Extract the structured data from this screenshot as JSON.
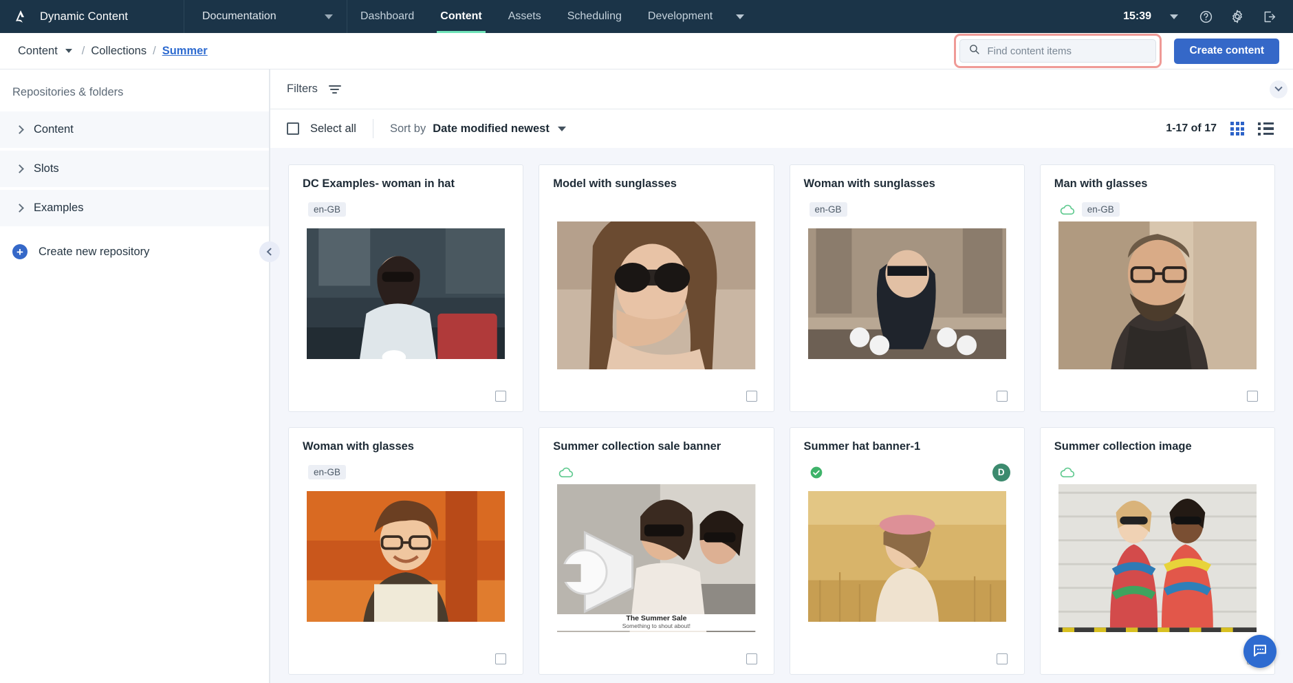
{
  "topnav": {
    "brand": "Dynamic Content",
    "section": {
      "label": "Documentation",
      "icon": "chevron-down-icon"
    },
    "items": [
      {
        "label": "Dashboard",
        "active": false,
        "caret": false
      },
      {
        "label": "Content",
        "active": true,
        "caret": false
      },
      {
        "label": "Assets",
        "active": false,
        "caret": false
      },
      {
        "label": "Scheduling",
        "active": false,
        "caret": false
      },
      {
        "label": "Development",
        "active": false,
        "caret": true
      }
    ],
    "clock": "15:39",
    "icons": [
      "chevron-down-icon",
      "help-icon",
      "gear-icon",
      "logout-icon"
    ]
  },
  "breadcrumb": {
    "items": [
      {
        "label": "Content",
        "caret": true,
        "active": false
      },
      {
        "label": "/",
        "sep": true
      },
      {
        "label": "Collections",
        "active": false
      },
      {
        "label": "/",
        "sep": true
      },
      {
        "label": "Summer",
        "active": true
      }
    ]
  },
  "search": {
    "placeholder": "Find content items",
    "value": "",
    "icon": "search-icon",
    "highlight_color": "#ef9a96"
  },
  "actions": {
    "create_content": "Create content",
    "accent": "#3568c8"
  },
  "sidebar": {
    "title": "Repositories & folders",
    "items": [
      {
        "label": "Content",
        "icon": "chevron-right-icon"
      },
      {
        "label": "Slots",
        "icon": "chevron-right-icon"
      },
      {
        "label": "Examples",
        "icon": "chevron-right-icon"
      }
    ],
    "create_repository": "Create new repository",
    "create_repository_icon": "plus-circle-icon"
  },
  "filterbar": {
    "label": "Filters",
    "icon": "filter-icon",
    "collapse_icon": "chevron-down-icon"
  },
  "toolbar": {
    "select_all": "Select all",
    "sort_by_label": "Sort by",
    "sort_by_value": "Date modified newest",
    "sort_caret": "chevron-down-icon",
    "count": "1-17 of 17",
    "grid_view_icon": "grid-view-icon",
    "list_view_icon": "list-view-icon",
    "collapse_panel_icon": "chevron-left-icon"
  },
  "cards": [
    {
      "title": "DC Examples- woman in hat",
      "locale": "en-GB",
      "status_icon": null,
      "avatar": null,
      "thumb": "woman-in-hat",
      "checkbox": false
    },
    {
      "title": "Model with sunglasses",
      "locale": null,
      "status_icon": null,
      "avatar": null,
      "thumb": "model-sunglasses",
      "checkbox": false
    },
    {
      "title": "Woman with sunglasses",
      "locale": "en-GB",
      "status_icon": null,
      "avatar": null,
      "thumb": "woman-sunglasses-street",
      "checkbox": false
    },
    {
      "title": "Man with glasses",
      "locale": "en-GB",
      "status_icon": "cloud-icon",
      "avatar": null,
      "thumb": "man-glasses",
      "checkbox": false
    },
    {
      "title": "Woman with glasses",
      "locale": "en-GB",
      "status_icon": null,
      "avatar": null,
      "thumb": "woman-glasses-autumn",
      "checkbox": false
    },
    {
      "title": "Summer collection sale banner",
      "locale": null,
      "status_icon": "cloud-icon",
      "avatar": null,
      "thumb": "megaphone-banner",
      "caption_line1": "The Summer Sale",
      "caption_line2": "Something to shout about!",
      "checkbox": false
    },
    {
      "title": "Summer hat banner-1",
      "locale": null,
      "status_icon": "published-tick-icon",
      "avatar": "D",
      "avatar_color": "#3c8a6e",
      "thumb": "woman-field-hat",
      "checkbox": false
    },
    {
      "title": "Summer collection image",
      "locale": null,
      "status_icon": "cloud-icon",
      "avatar": null,
      "thumb": "two-women-wall",
      "checkbox": false
    }
  ],
  "chat": {
    "icon": "chat-icon",
    "color": "#2e6bd0"
  }
}
